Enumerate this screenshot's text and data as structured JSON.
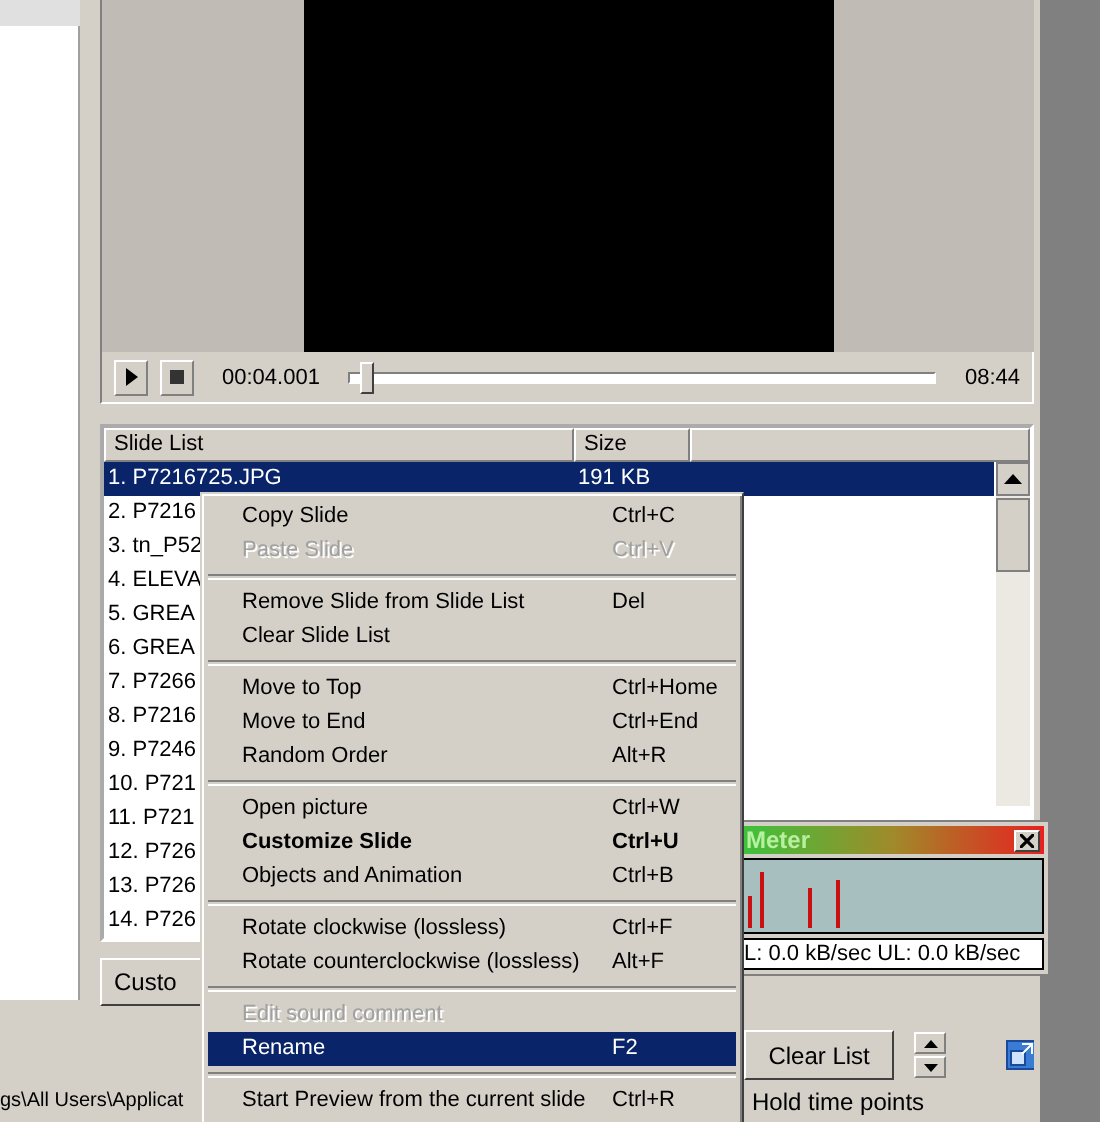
{
  "player": {
    "time": "00:04.001",
    "duration": "08:44",
    "level": 0.02
  },
  "slide_list": {
    "columns": [
      "Slide List",
      "Size"
    ],
    "rows": [
      {
        "name": "1. P7216725.JPG",
        "size": "191 KB",
        "selected": true
      },
      {
        "name": "2. P7216",
        "selected": false
      },
      {
        "name": "3. tn_P52",
        "selected": false
      },
      {
        "name": "4. ELEVA",
        "selected": false
      },
      {
        "name": "5. GREA",
        "selected": false
      },
      {
        "name": "6. GREA",
        "selected": false
      },
      {
        "name": "7. P7266",
        "selected": false
      },
      {
        "name": "8. P7216",
        "selected": false
      },
      {
        "name": "9. P7246",
        "selected": false
      },
      {
        "name": "10. P721",
        "selected": false
      },
      {
        "name": "11. P721",
        "selected": false
      },
      {
        "name": "12. P726",
        "selected": false
      },
      {
        "name": "13. P726",
        "selected": false
      },
      {
        "name": "14. P726",
        "selected": false
      }
    ]
  },
  "customize_button": "Custo",
  "meter": {
    "title": "Meter",
    "readout": "L: 0.0 kB/sec  UL: 0.0 kB/sec"
  },
  "clear_button": "Clear List",
  "status": {
    "path": "gs\\All Users\\Applicat",
    "hold": "Hold time points"
  },
  "context_menu": {
    "groups": [
      [
        {
          "label": "Copy Slide",
          "shortcut": "Ctrl+C",
          "disabled": false,
          "bold": false,
          "selected": false
        },
        {
          "label": "Paste Slide",
          "shortcut": "Ctrl+V",
          "disabled": true,
          "bold": false,
          "selected": false
        }
      ],
      [
        {
          "label": "Remove Slide from Slide List",
          "shortcut": "Del",
          "disabled": false,
          "bold": false,
          "selected": false
        },
        {
          "label": "Clear Slide List",
          "disabled": false,
          "bold": false,
          "selected": false
        }
      ],
      [
        {
          "label": "Move to Top",
          "shortcut": "Ctrl+Home",
          "disabled": false,
          "bold": false,
          "selected": false
        },
        {
          "label": "Move to End",
          "shortcut": "Ctrl+End",
          "disabled": false,
          "bold": false,
          "selected": false
        },
        {
          "label": "Random Order",
          "shortcut": "Alt+R",
          "disabled": false,
          "bold": false,
          "selected": false
        }
      ],
      [
        {
          "label": "Open picture",
          "shortcut": "Ctrl+W",
          "disabled": false,
          "bold": false,
          "selected": false
        },
        {
          "label": "Customize Slide",
          "shortcut": "Ctrl+U",
          "disabled": false,
          "bold": true,
          "selected": false
        },
        {
          "label": "Objects and Animation",
          "shortcut": "Ctrl+B",
          "disabled": false,
          "bold": false,
          "selected": false
        }
      ],
      [
        {
          "label": "Rotate clockwise (lossless)",
          "shortcut": "Ctrl+F",
          "disabled": false,
          "bold": false,
          "selected": false
        },
        {
          "label": "Rotate counterclockwise (lossless)",
          "shortcut": "Alt+F",
          "disabled": false,
          "bold": false,
          "selected": false
        }
      ],
      [
        {
          "label": "Edit sound comment",
          "disabled": true,
          "bold": false,
          "selected": false
        },
        {
          "label": "Rename",
          "shortcut": "F2",
          "disabled": false,
          "bold": false,
          "selected": true
        }
      ],
      [
        {
          "label": "Start Preview from the current slide",
          "shortcut": "Ctrl+R",
          "disabled": false,
          "bold": false,
          "selected": false
        }
      ]
    ]
  }
}
